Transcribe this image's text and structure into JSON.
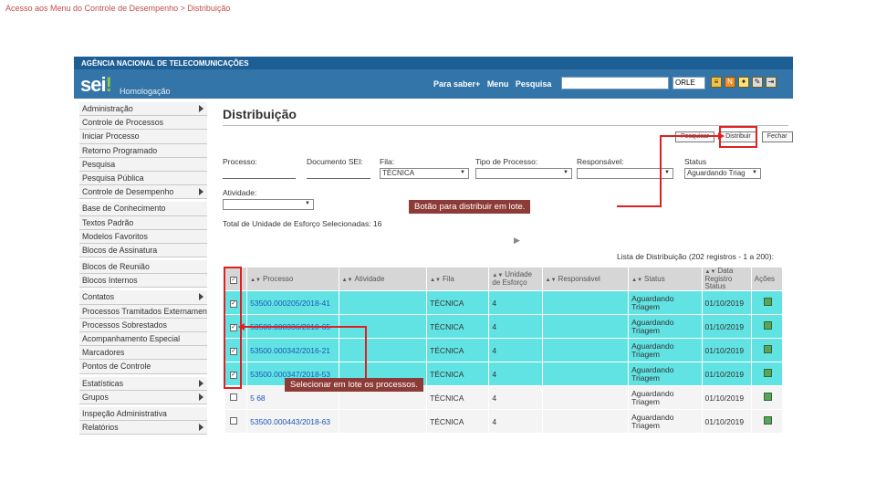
{
  "breadcrumb": "Acesso aos Menu do Controle de Desempenho > Distribuição",
  "app": {
    "org": "AGÊNCIA NACIONAL DE TELECOMUNICAÇÕES",
    "logo": "sei",
    "logo_mark": "!",
    "env": "Homologação",
    "links": [
      "Para saber+",
      "Menu",
      "Pesquisa"
    ],
    "unit": "ORLE",
    "icons": [
      "menu-lines-icon",
      "n-icon",
      "bulb-icon",
      "tool-icon",
      "exit-icon"
    ]
  },
  "sidebar": {
    "items": [
      {
        "label": "Administração",
        "arrow": true
      },
      {
        "label": "Controle de Processos",
        "arrow": false
      },
      {
        "label": "Iniciar Processo",
        "arrow": false
      },
      {
        "label": "Retorno Programado",
        "arrow": false
      },
      {
        "label": "Pesquisa",
        "arrow": false
      },
      {
        "label": "Pesquisa Pública",
        "arrow": false
      },
      {
        "label": "Controle de Desempenho",
        "arrow": true
      },
      {
        "label": "Base de Conhecimento",
        "arrow": false
      },
      {
        "label": "Textos Padrão",
        "arrow": false
      },
      {
        "label": "Modelos Favoritos",
        "arrow": false
      },
      {
        "label": "Blocos de Assinatura",
        "arrow": false
      },
      {
        "label": "Blocos de Reunião",
        "arrow": false
      },
      {
        "label": "Blocos Internos",
        "arrow": false
      },
      {
        "label": "Contatos",
        "arrow": true
      },
      {
        "label": "Processos Tramitados Externamente",
        "arrow": false
      },
      {
        "label": "Processos Sobrestados",
        "arrow": false
      },
      {
        "label": "Acompanhamento Especial",
        "arrow": false
      },
      {
        "label": "Marcadores",
        "arrow": false
      },
      {
        "label": "Pontos de Controle",
        "arrow": false
      },
      {
        "label": "Estatísticas",
        "arrow": true
      },
      {
        "label": "Grupos",
        "arrow": true
      },
      {
        "label": "Inspeção Administrativa",
        "arrow": false
      },
      {
        "label": "Relatórios",
        "arrow": true
      }
    ]
  },
  "page": {
    "title": "Distribuição",
    "buttons": [
      "Pesquisar",
      "Distribuir",
      "Fechar"
    ],
    "filters": {
      "processo_label": "Processo:",
      "documento_label": "Documento SEI:",
      "fila_label": "Fila:",
      "fila_value": "TÉCNICA",
      "tipo_label": "Tipo de Processo:",
      "responsavel_label": "Responsável:",
      "status_label": "Status",
      "status_value": "Aguardando Triag",
      "atividade_label": "Atividade:"
    },
    "total_text": "Total de Unidade de Esforço Selecionadas: 16",
    "list_caption": "Lista de Distribuição (202 registros - 1 a 200):",
    "callout_top": "Botão para distribuir em lote.",
    "callout_left": "Selecionar em lote os processos."
  },
  "table": {
    "headers": [
      "Processo",
      "Atividade",
      "Fila",
      "Unidade de Esforço",
      "Responsável",
      "Status",
      "Data Registro Status",
      "Ações"
    ],
    "rows": [
      {
        "checked": true,
        "highlight": true,
        "processo": "53500.000205/2018-41",
        "fila": "TÉCNICA",
        "ue": "4",
        "status": "Aguardando Triagem",
        "data": "01/10/2019"
      },
      {
        "checked": true,
        "highlight": true,
        "processo": "53500.000336/2018-65",
        "fila": "TÉCNICA",
        "ue": "4",
        "status": "Aguardando Triagem",
        "data": "01/10/2019"
      },
      {
        "checked": true,
        "highlight": true,
        "processo": "53500.000342/2016-21",
        "fila": "TÉCNICA",
        "ue": "4",
        "status": "Aguardando Triagem",
        "data": "01/10/2019"
      },
      {
        "checked": true,
        "highlight": true,
        "processo": "53500.000347/2018-53",
        "fila": "TÉCNICA",
        "ue": "4",
        "status": "Aguardando Triagem",
        "data": "01/10/2019"
      },
      {
        "checked": false,
        "highlight": false,
        "processo": "5 68",
        "fila": "TÉCNICA",
        "ue": "4",
        "status": "Aguardando Triagem",
        "data": "01/10/2019"
      },
      {
        "checked": false,
        "highlight": false,
        "processo": "53500.000443/2018-63",
        "fila": "TÉCNICA",
        "ue": "4",
        "status": "Aguardando Triagem",
        "data": "01/10/2019"
      }
    ]
  },
  "colors": {
    "topbar": "#1d5e94",
    "header": "#3375a8",
    "highlight_row": "#62e3e3",
    "callout": "#8c3b37",
    "annotation": "#e02020"
  }
}
